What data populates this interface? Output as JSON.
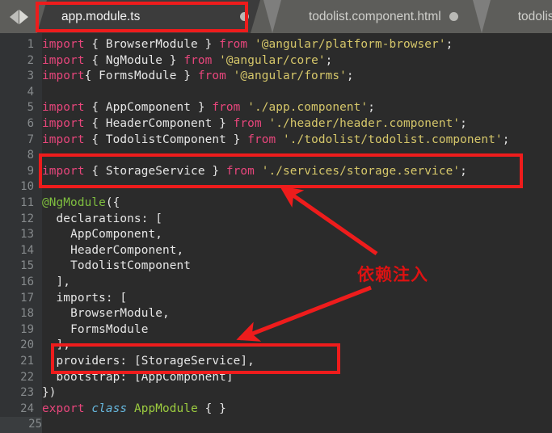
{
  "window": {
    "kind": "code-editor",
    "theme_bg": "#2b2b2b",
    "gutter_bg": "#313335",
    "tabbar_bg": "#5d5d5a",
    "annotation_color": "#ee1c1c"
  },
  "tabbar": {
    "nav_prev_icon": "chevron-left-icon",
    "nav_next_icon": "chevron-right-icon",
    "tabs": [
      {
        "label": "app.module.ts",
        "active": true,
        "modified_dot": true
      },
      {
        "label": "todolist.component.html",
        "active": false,
        "modified_dot": true
      },
      {
        "label": "todolist.co",
        "active": false,
        "modified_dot": false
      }
    ]
  },
  "editor": {
    "line_numbers": [
      "1",
      "2",
      "3",
      "4",
      "5",
      "6",
      "7",
      "8",
      "9",
      "10",
      "11",
      "12",
      "13",
      "14",
      "15",
      "16",
      "17",
      "18",
      "19",
      "20",
      "21",
      "22",
      "23",
      "24",
      "25"
    ],
    "current_line": 25,
    "lines": [
      {
        "n": 1,
        "text": "import { BrowserModule } from '@angular/platform-browser';"
      },
      {
        "n": 2,
        "text": "import { NgModule } from '@angular/core';"
      },
      {
        "n": 3,
        "text": "import{ FormsModule } from '@angular/forms';"
      },
      {
        "n": 4,
        "text": ""
      },
      {
        "n": 5,
        "text": "import { AppComponent } from './app.component';"
      },
      {
        "n": 6,
        "text": "import { HeaderComponent } from './header/header.component';"
      },
      {
        "n": 7,
        "text": "import { TodolistComponent } from './todolist/todolist.component';"
      },
      {
        "n": 8,
        "text": ""
      },
      {
        "n": 9,
        "text": "import { StorageService } from './services/storage.service';"
      },
      {
        "n": 10,
        "text": ""
      },
      {
        "n": 11,
        "text": "@NgModule({"
      },
      {
        "n": 12,
        "text": "  declarations: ["
      },
      {
        "n": 13,
        "text": "    AppComponent,"
      },
      {
        "n": 14,
        "text": "    HeaderComponent,"
      },
      {
        "n": 15,
        "text": "    TodolistComponent"
      },
      {
        "n": 16,
        "text": "  ],"
      },
      {
        "n": 17,
        "text": "  imports: ["
      },
      {
        "n": 18,
        "text": "    BrowserModule,"
      },
      {
        "n": 19,
        "text": "    FormsModule"
      },
      {
        "n": 20,
        "text": "  ],"
      },
      {
        "n": 21,
        "text": "  providers: [StorageService],"
      },
      {
        "n": 22,
        "text": "  bootstrap: [AppComponent]"
      },
      {
        "n": 23,
        "text": "})"
      },
      {
        "n": 24,
        "text": "export class AppModule { }"
      },
      {
        "n": 25,
        "text": ""
      }
    ]
  },
  "annotations": {
    "note_text": "依赖注入",
    "boxes": [
      {
        "id": "tab-highlight",
        "target": "app.module.ts tab"
      },
      {
        "id": "import-highlight",
        "target": "import { StorageService } ..."
      },
      {
        "id": "providers-highlight",
        "target": "providers: [StorageService],"
      }
    ],
    "arrows": [
      {
        "id": "arrow-to-import",
        "from": "note",
        "to": "import-highlight"
      },
      {
        "id": "arrow-to-providers",
        "from": "note",
        "to": "providers-highlight"
      }
    ]
  }
}
